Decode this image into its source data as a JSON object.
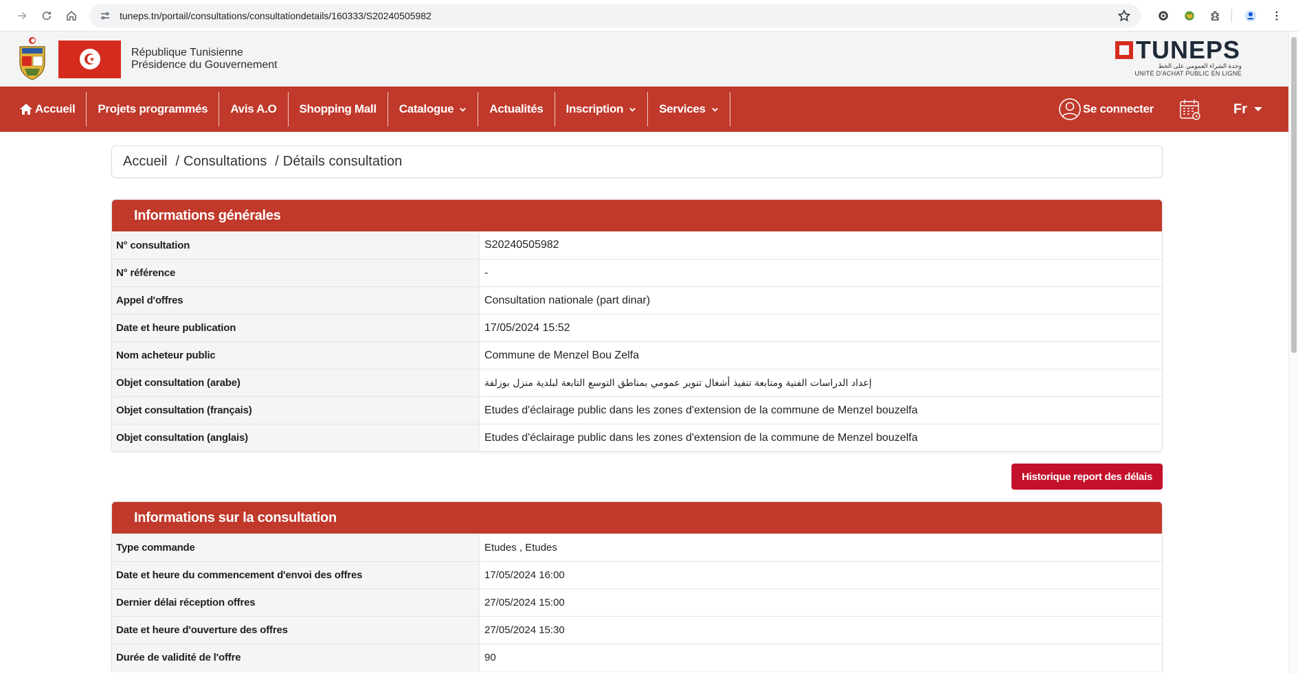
{
  "browser": {
    "url": "tuneps.tn/portail/consultations/consultationdetails/160333/S20240505982"
  },
  "gov": {
    "line1": "République Tunisienne",
    "line2": "Présidence du Gouvernement",
    "logo_text": "TUNEPS",
    "logo_arabic": "وحدة الشراء العمومي على الخط",
    "logo_sub": "UNITÉ D'ACHAT PUBLIC EN LIGNE"
  },
  "nav": {
    "items": [
      {
        "label": "Accueil"
      },
      {
        "label": "Projets programmés"
      },
      {
        "label": "Avis A.O"
      },
      {
        "label": "Shopping Mall"
      },
      {
        "label": "Catalogue"
      },
      {
        "label": "Actualités"
      },
      {
        "label": "Inscription"
      },
      {
        "label": "Services"
      }
    ],
    "login": "Se connecter",
    "lang": "Fr"
  },
  "breadcrumb": {
    "items": [
      "Accueil",
      "Consultations",
      "Détails consultation"
    ],
    "sep": "/"
  },
  "general": {
    "title": "Informations générales",
    "rows": [
      {
        "label": "N° consultation",
        "value": "S20240505982"
      },
      {
        "label": "N° référence",
        "value": "-"
      },
      {
        "label": "Appel d'offres",
        "value": "Consultation nationale (part dinar)"
      },
      {
        "label": "Date et heure publication",
        "value": "17/05/2024 15:52"
      },
      {
        "label": "Nom acheteur public",
        "value": "Commune de Menzel Bou Zelfa"
      },
      {
        "label": "Objet consultation (arabe)",
        "value": "إعداد الدراسات الفنية ومتابعة تنفيذ أشغال تنوير عمومي بمناطق التوسع التابعة لبلدية منزل بوزلفة"
      },
      {
        "label": "Objet consultation (français)",
        "value": "Etudes d'éclairage public dans les zones d'extension de la commune de Menzel bouzelfa"
      },
      {
        "label": "Objet consultation (anglais)",
        "value": "Etudes d'éclairage public dans les zones d'extension de la commune de Menzel bouzelfa"
      }
    ]
  },
  "history_button": "Historique report des délais",
  "consultation": {
    "title": "Informations sur la consultation",
    "rows": [
      {
        "label": "Type commande",
        "value": "Etudes , Etudes"
      },
      {
        "label": "Date et heure du commencement d'envoi des offres",
        "value": "17/05/2024 16:00"
      },
      {
        "label": "Dernier délai réception offres",
        "value": "27/05/2024 15:00"
      },
      {
        "label": "Date et heure d'ouverture des offres",
        "value": "27/05/2024 15:30"
      },
      {
        "label": "Durée de validité de l'offre",
        "value": "90"
      }
    ]
  },
  "colors": {
    "brand_red": "#c0392b",
    "button_red": "#c4102b"
  }
}
